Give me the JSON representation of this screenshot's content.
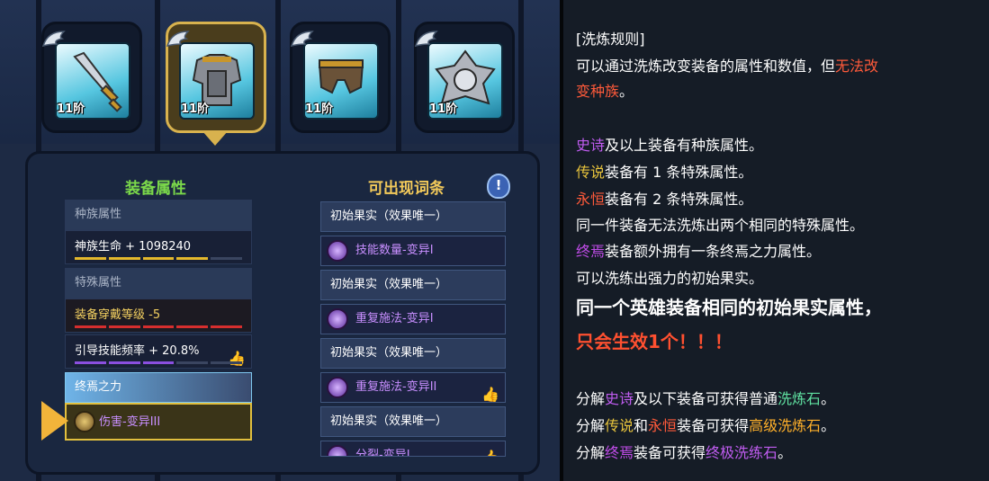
{
  "equipment_slots": [
    {
      "tier": "11阶",
      "icon": "sword-icon",
      "selected": false
    },
    {
      "tier": "11阶",
      "icon": "armor-icon",
      "selected": true
    },
    {
      "tier": "11阶",
      "icon": "pants-icon",
      "selected": false
    },
    {
      "tier": "11阶",
      "icon": "shield-icon",
      "selected": false
    }
  ],
  "attributes": {
    "header": "装备属性",
    "race_category": "种族属性",
    "race_value": "神族生命 + 1098240",
    "special_category": "特殊属性",
    "special_1": "装备穿戴等级  -5",
    "special_2": "引导技能频率 + 20.8%",
    "zhongyan_category": "终焉之力",
    "zhongyan_value": "伤害-变异III"
  },
  "candidates": {
    "header": "可出现词条",
    "items": [
      {
        "text": "初始果实（效果唯一）",
        "kind": "fruit"
      },
      {
        "text": "技能数量-变异I",
        "kind": "skill"
      },
      {
        "text": "初始果实（效果唯一）",
        "kind": "fruit"
      },
      {
        "text": "重复施法-变异I",
        "kind": "skill"
      },
      {
        "text": "初始果实（效果唯一）",
        "kind": "fruit"
      },
      {
        "text": "重复施法-变异II",
        "kind": "skill",
        "recommended": true
      },
      {
        "text": "初始果实（效果唯一）",
        "kind": "fruit"
      },
      {
        "text": "分裂-变异I",
        "kind": "skill",
        "recommended": true
      }
    ]
  },
  "info_button_label": "!",
  "rules": {
    "title": "[洗炼规则]",
    "l1a": "可以通过洗炼改变装备的属性和数值，但",
    "l1b": "无法改",
    "l2a": "变种族",
    "l2b": "。",
    "l3a": "史诗",
    "l3b": "及以上装备有种族属性。",
    "l4a": "传说",
    "l4b": "装备有 1 条特殊属性。",
    "l5a": "永恒",
    "l5b": "装备有 2 条特殊属性。",
    "l6": "同一件装备无法洗炼出两个相同的特殊属性。",
    "l7a": "终焉",
    "l7b": "装备额外拥有一条终焉之力属性。",
    "l8": "可以洗练出强力的初始果实。",
    "l9": "同一个英雄装备相同的初始果实属性，",
    "l10": "只会生效1个！！！",
    "l11a": "分解",
    "l11b": "史诗",
    "l11c": "及以下装备可获得普通",
    "l11d": "洗炼石",
    "l11e": "。",
    "l12a": "分解",
    "l12b": "传说",
    "l12c": "和",
    "l12d": "永恒",
    "l12e": "装备可获得",
    "l12f": "高级洗炼石",
    "l12g": "。",
    "l13a": "分解",
    "l13b": "终焉",
    "l13c": "装备可获得",
    "l13d": "终极洗练石",
    "l13e": "。"
  },
  "colors": {
    "epic": "#c05cf0",
    "legend": "#e8c43c",
    "eternal": "#ff5a3a",
    "ultimate": "#c04ce8",
    "accent_gold": "#d8b24e"
  }
}
